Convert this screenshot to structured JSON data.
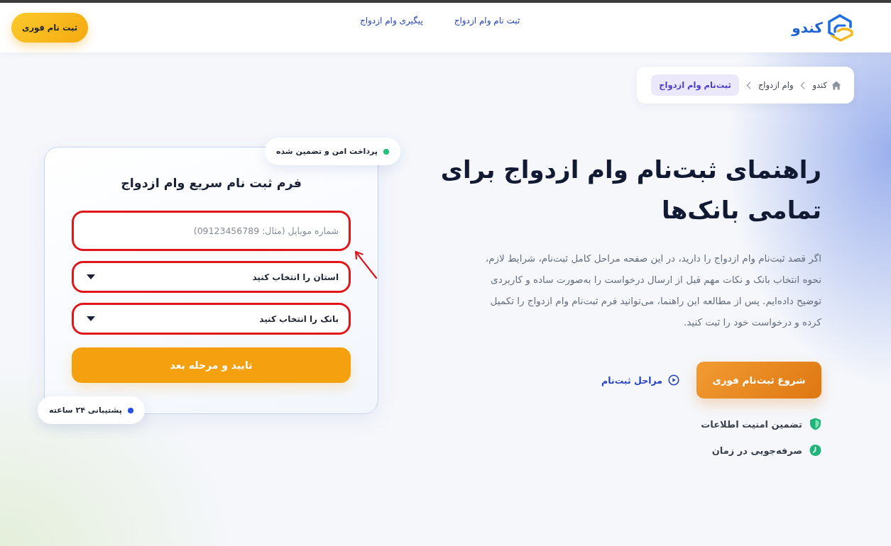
{
  "header": {
    "logo_text": "کندو",
    "nav": [
      {
        "label": "ثبت نام وام ازدواج"
      },
      {
        "label": "پیگیری وام ازدواج"
      }
    ],
    "cta": "ثبت نام فوری"
  },
  "breadcrumb": [
    {
      "label": "کندو",
      "selected": false
    },
    {
      "label": "وام ازدواج",
      "selected": false
    },
    {
      "label": "ثبت‌نام وام ازدواج",
      "selected": true
    }
  ],
  "hero": {
    "title_lines": [
      "راهنمای ثبت‌نام وام ازدواج برای",
      "تمامی بانک‌ها"
    ],
    "description": "اگر قصد ثبت‌نام وام ازدواج را دارید، در این صفحه مراحل کامل ثبت‌نام، شرایط لازم، نحوه انتخاب بانک و نکات مهم قبل از ارسال درخواست را به‌صورت ساده و کاربردی توضیح داده‌ایم. پس از مطالعه این راهنما، می‌توانید فرم ثبت‌نام وام ازدواج را تکمیل کرده و درخواست خود را ثبت کنید.",
    "primary_button": "شروع ثبت‌نام فوری",
    "secondary_link": "مراحل ثبت‌نام",
    "features": [
      {
        "kind": "shield",
        "label": "تضمین امنیت اطلاعات"
      },
      {
        "kind": "clock",
        "label": "صرفه‌جویی در زمان"
      }
    ]
  },
  "form": {
    "badge_top": {
      "label": "پرداخت امن و تضمین شده",
      "color": "#22c07a"
    },
    "title": "فرم ثبت نام سریع وام ازدواج",
    "fields": [
      {
        "kind": "input",
        "placeholder": "شماره موبایل (مثال: 09123456789)",
        "highlighted": true
      },
      {
        "kind": "select",
        "value": "استان را انتخاب کنید",
        "highlighted": true
      },
      {
        "kind": "select",
        "value": "بانک را انتخاب کنید",
        "highlighted": true
      }
    ],
    "submit": "تایید و مرحله بعد",
    "badge_bottom": {
      "label": "پشتیبانی ۲۴ ساعته",
      "color": "#2550e0"
    }
  }
}
